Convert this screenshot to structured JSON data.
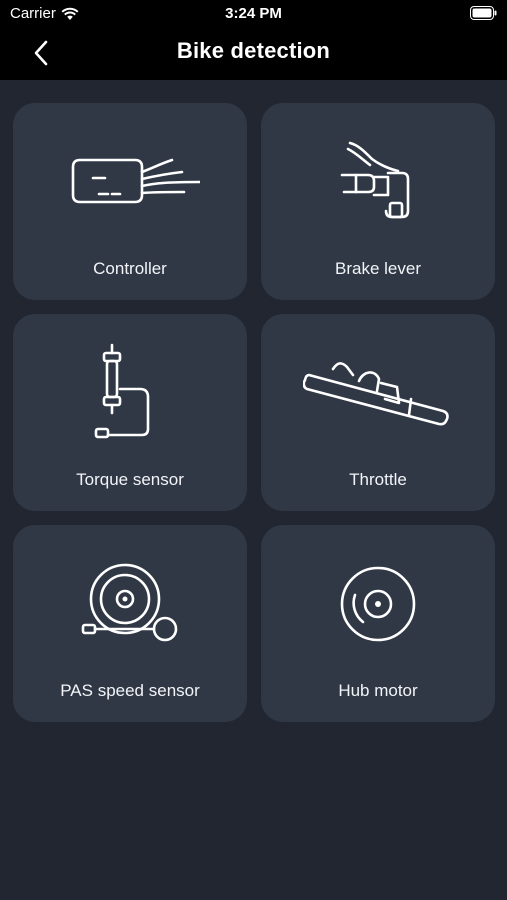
{
  "status_bar": {
    "carrier": "Carrier",
    "time": "3:24 PM"
  },
  "nav": {
    "title": "Bike detection"
  },
  "items": [
    {
      "label": "Controller",
      "icon": "controller-icon"
    },
    {
      "label": "Brake lever",
      "icon": "brake-lever-icon"
    },
    {
      "label": "Torque sensor",
      "icon": "torque-sensor-icon"
    },
    {
      "label": "Throttle",
      "icon": "throttle-icon"
    },
    {
      "label": "PAS speed sensor",
      "icon": "pas-speed-sensor-icon"
    },
    {
      "label": "Hub motor",
      "icon": "hub-motor-icon"
    }
  ],
  "colors": {
    "background": "#212631",
    "card": "#303846",
    "bar": "#000000"
  }
}
